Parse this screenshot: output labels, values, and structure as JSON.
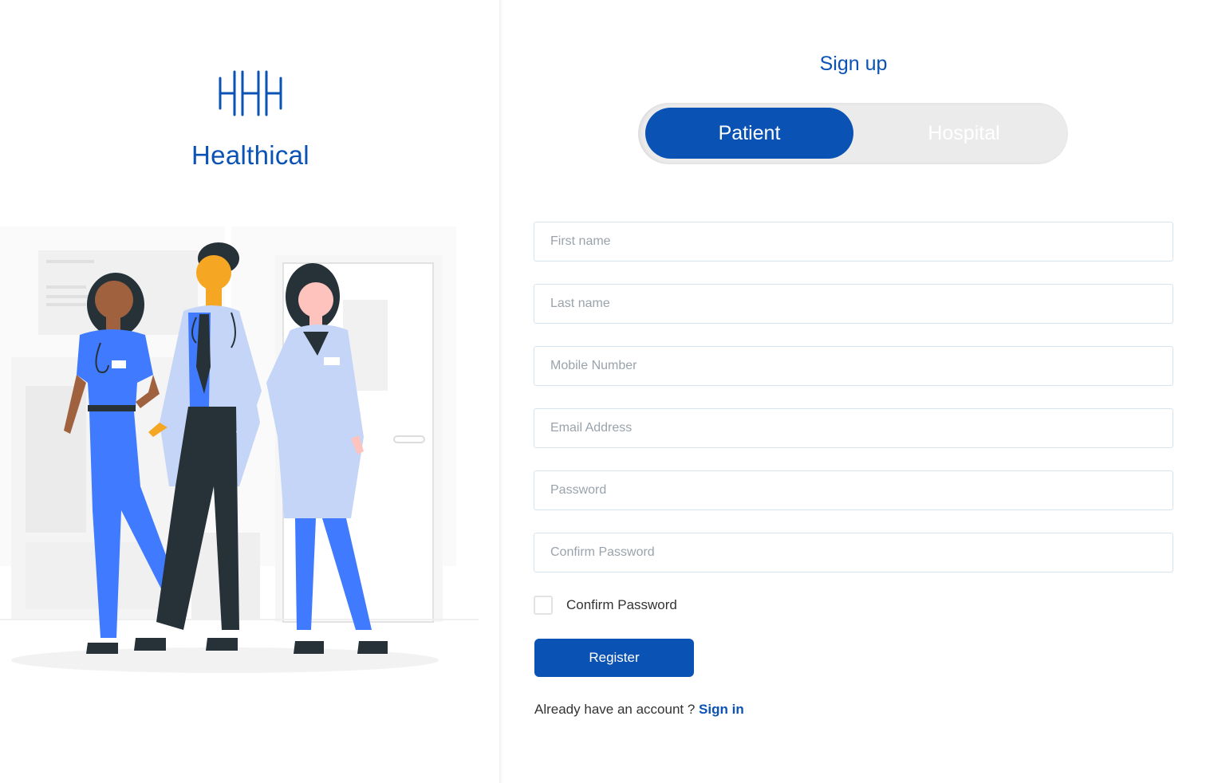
{
  "brand": {
    "name": "Healthical",
    "logo_icon": "hhh-logo-icon",
    "accent_color": "#0b52b5"
  },
  "illustration": {
    "icon": "medical-staff-illustration"
  },
  "signup": {
    "title": "Sign up",
    "tabs": [
      {
        "label": "Patient",
        "active": true
      },
      {
        "label": "Hospital",
        "active": false
      }
    ],
    "fields": {
      "first_name": {
        "placeholder": "First name",
        "value": ""
      },
      "last_name": {
        "placeholder": "Last name",
        "value": ""
      },
      "mobile": {
        "placeholder": "Mobile Number",
        "value": ""
      },
      "email": {
        "placeholder": "Email Address",
        "value": ""
      },
      "password": {
        "placeholder": "Password",
        "value": ""
      },
      "confirm_password": {
        "placeholder": "Confirm Password",
        "value": ""
      }
    },
    "checkbox": {
      "label": "Confirm Password",
      "checked": false
    },
    "register_label": "Register",
    "signin_prompt": "Already have an account ?",
    "signin_link": "Sign in"
  }
}
